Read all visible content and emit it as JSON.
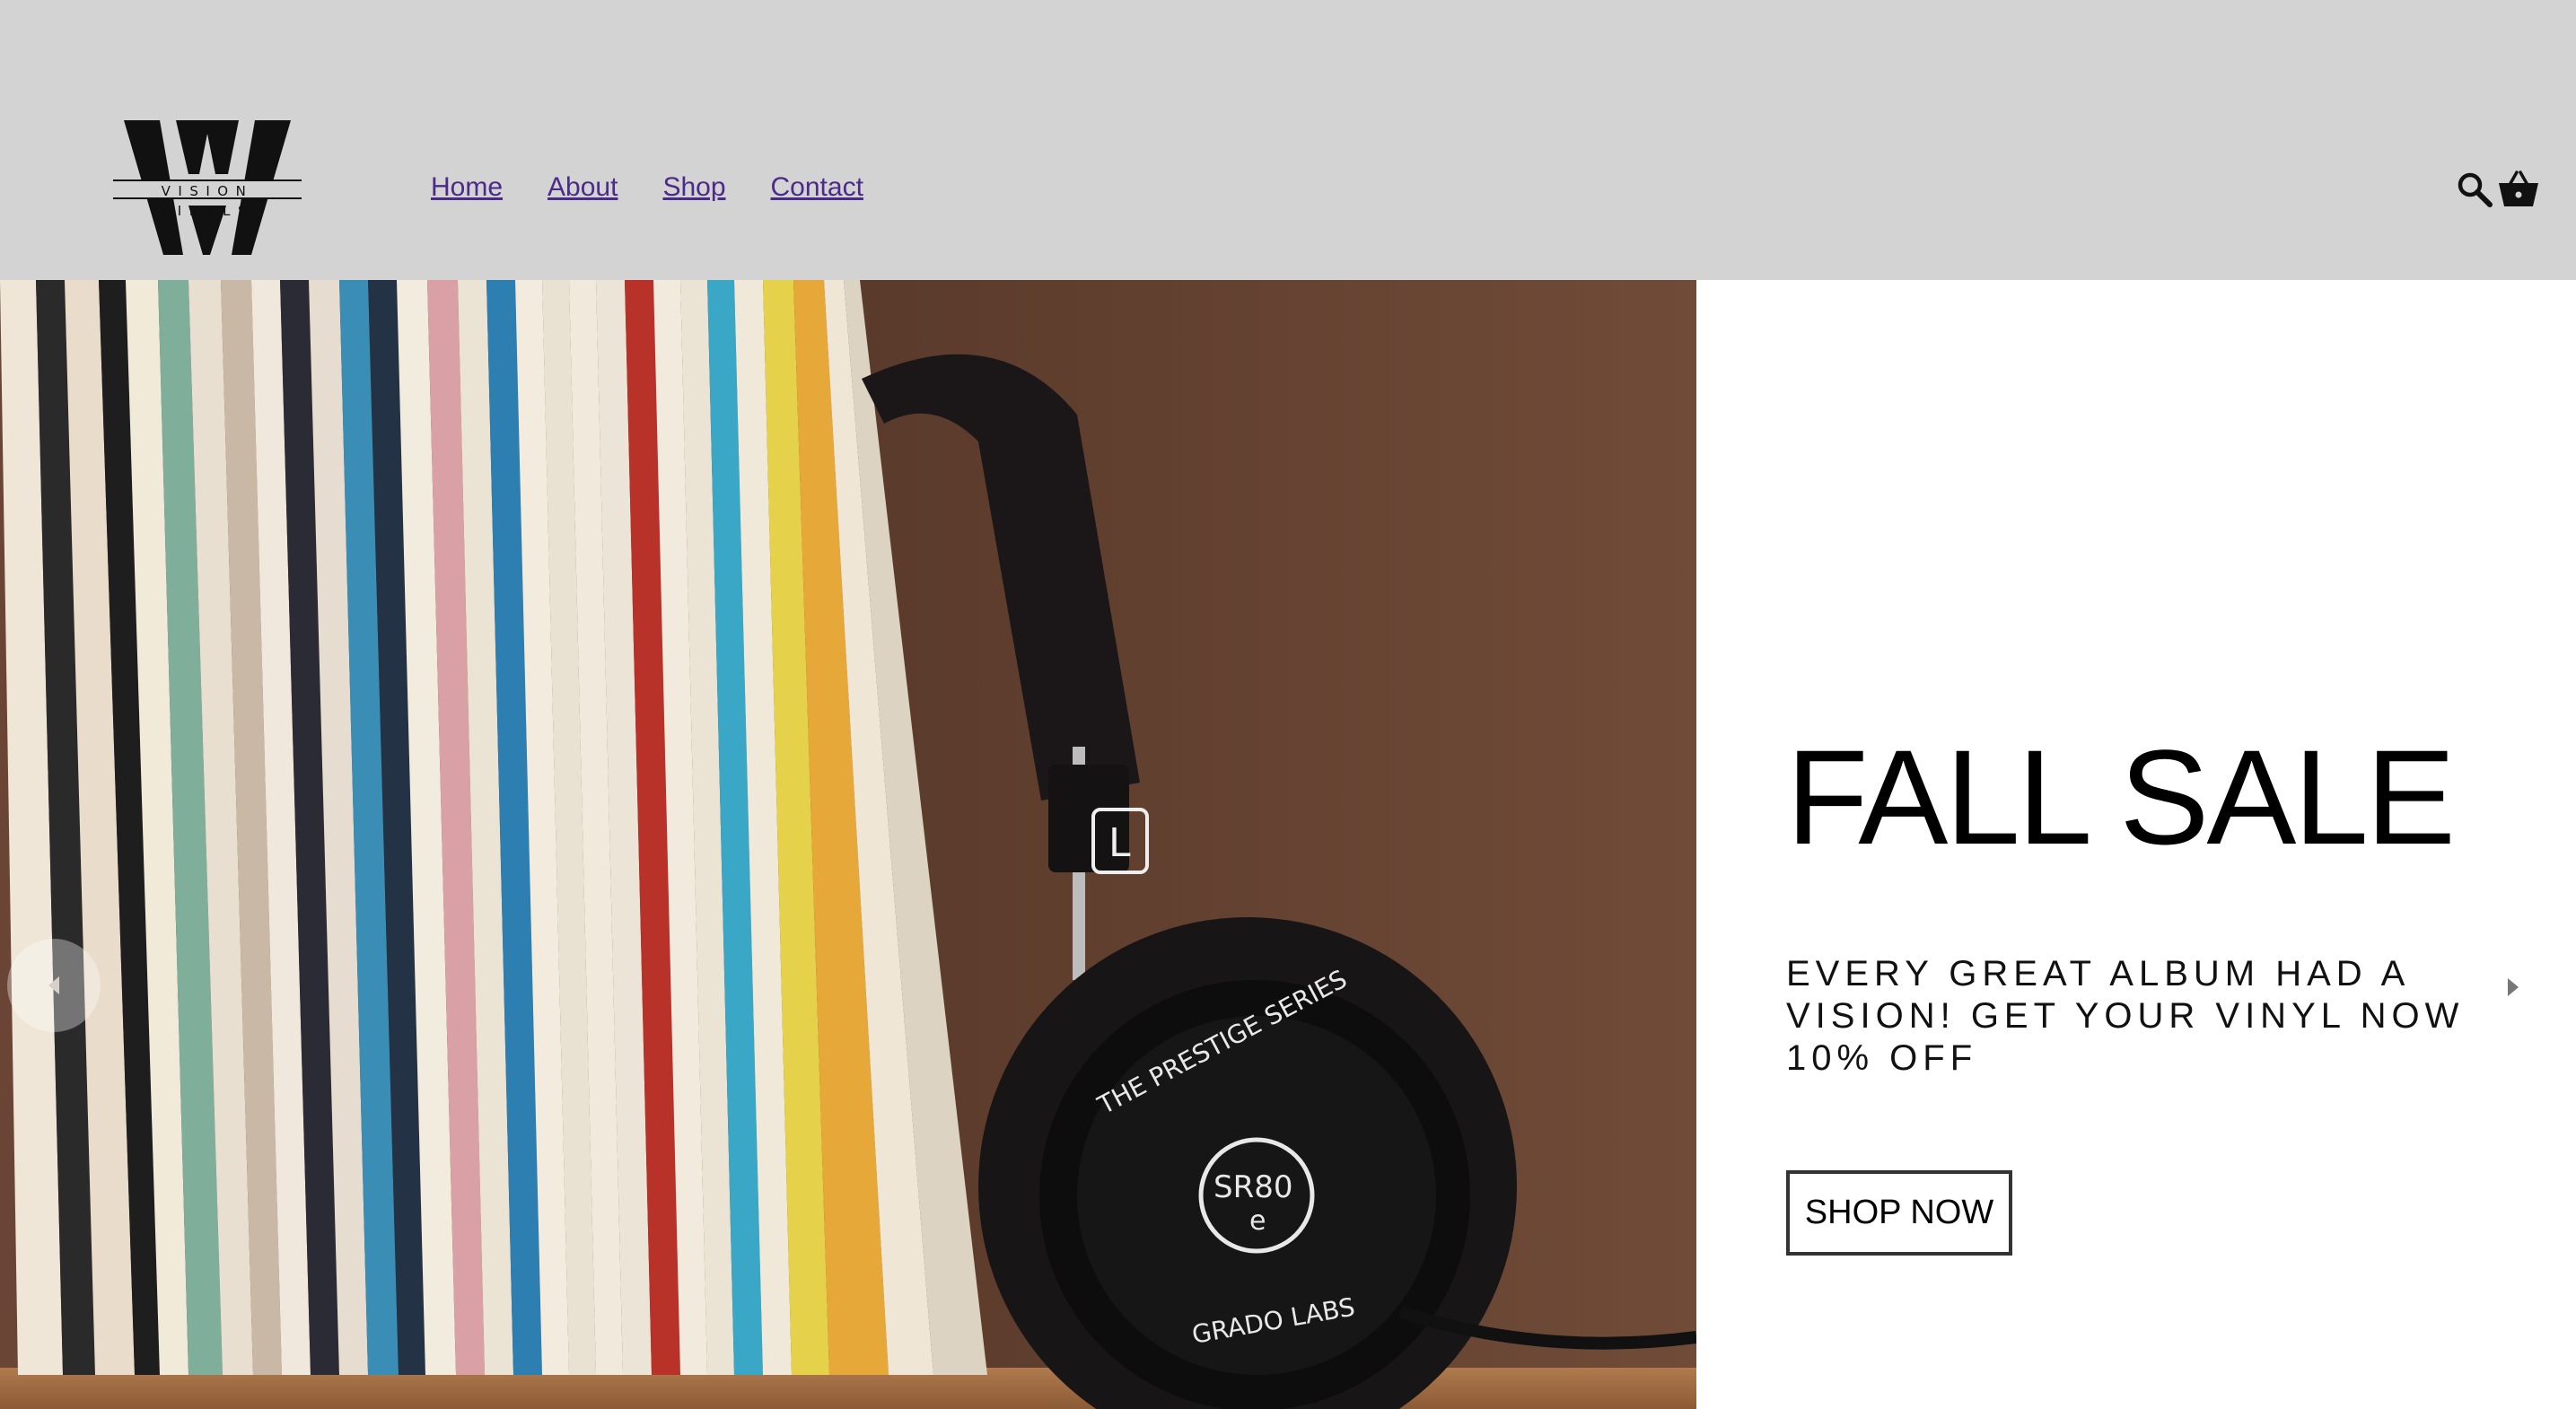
{
  "brand": {
    "logo_text": "VISION VINYLS"
  },
  "nav": {
    "items": [
      {
        "label": "Home"
      },
      {
        "label": "About"
      },
      {
        "label": "Shop"
      },
      {
        "label": "Contact"
      }
    ]
  },
  "header_icons": [
    "search-icon",
    "basket-icon"
  ],
  "hero": {
    "title": "FALL SALE",
    "subtitle": "EVERY GREAT ALBUM HAD A VISION! GET YOUR VINYL NOW 10% OFF",
    "cta_label": "SHOP NOW"
  },
  "colors": {
    "header_bg": "#d3d3d3",
    "nav_link": "#4b2a8a",
    "panel_bg": "#ffffff"
  }
}
